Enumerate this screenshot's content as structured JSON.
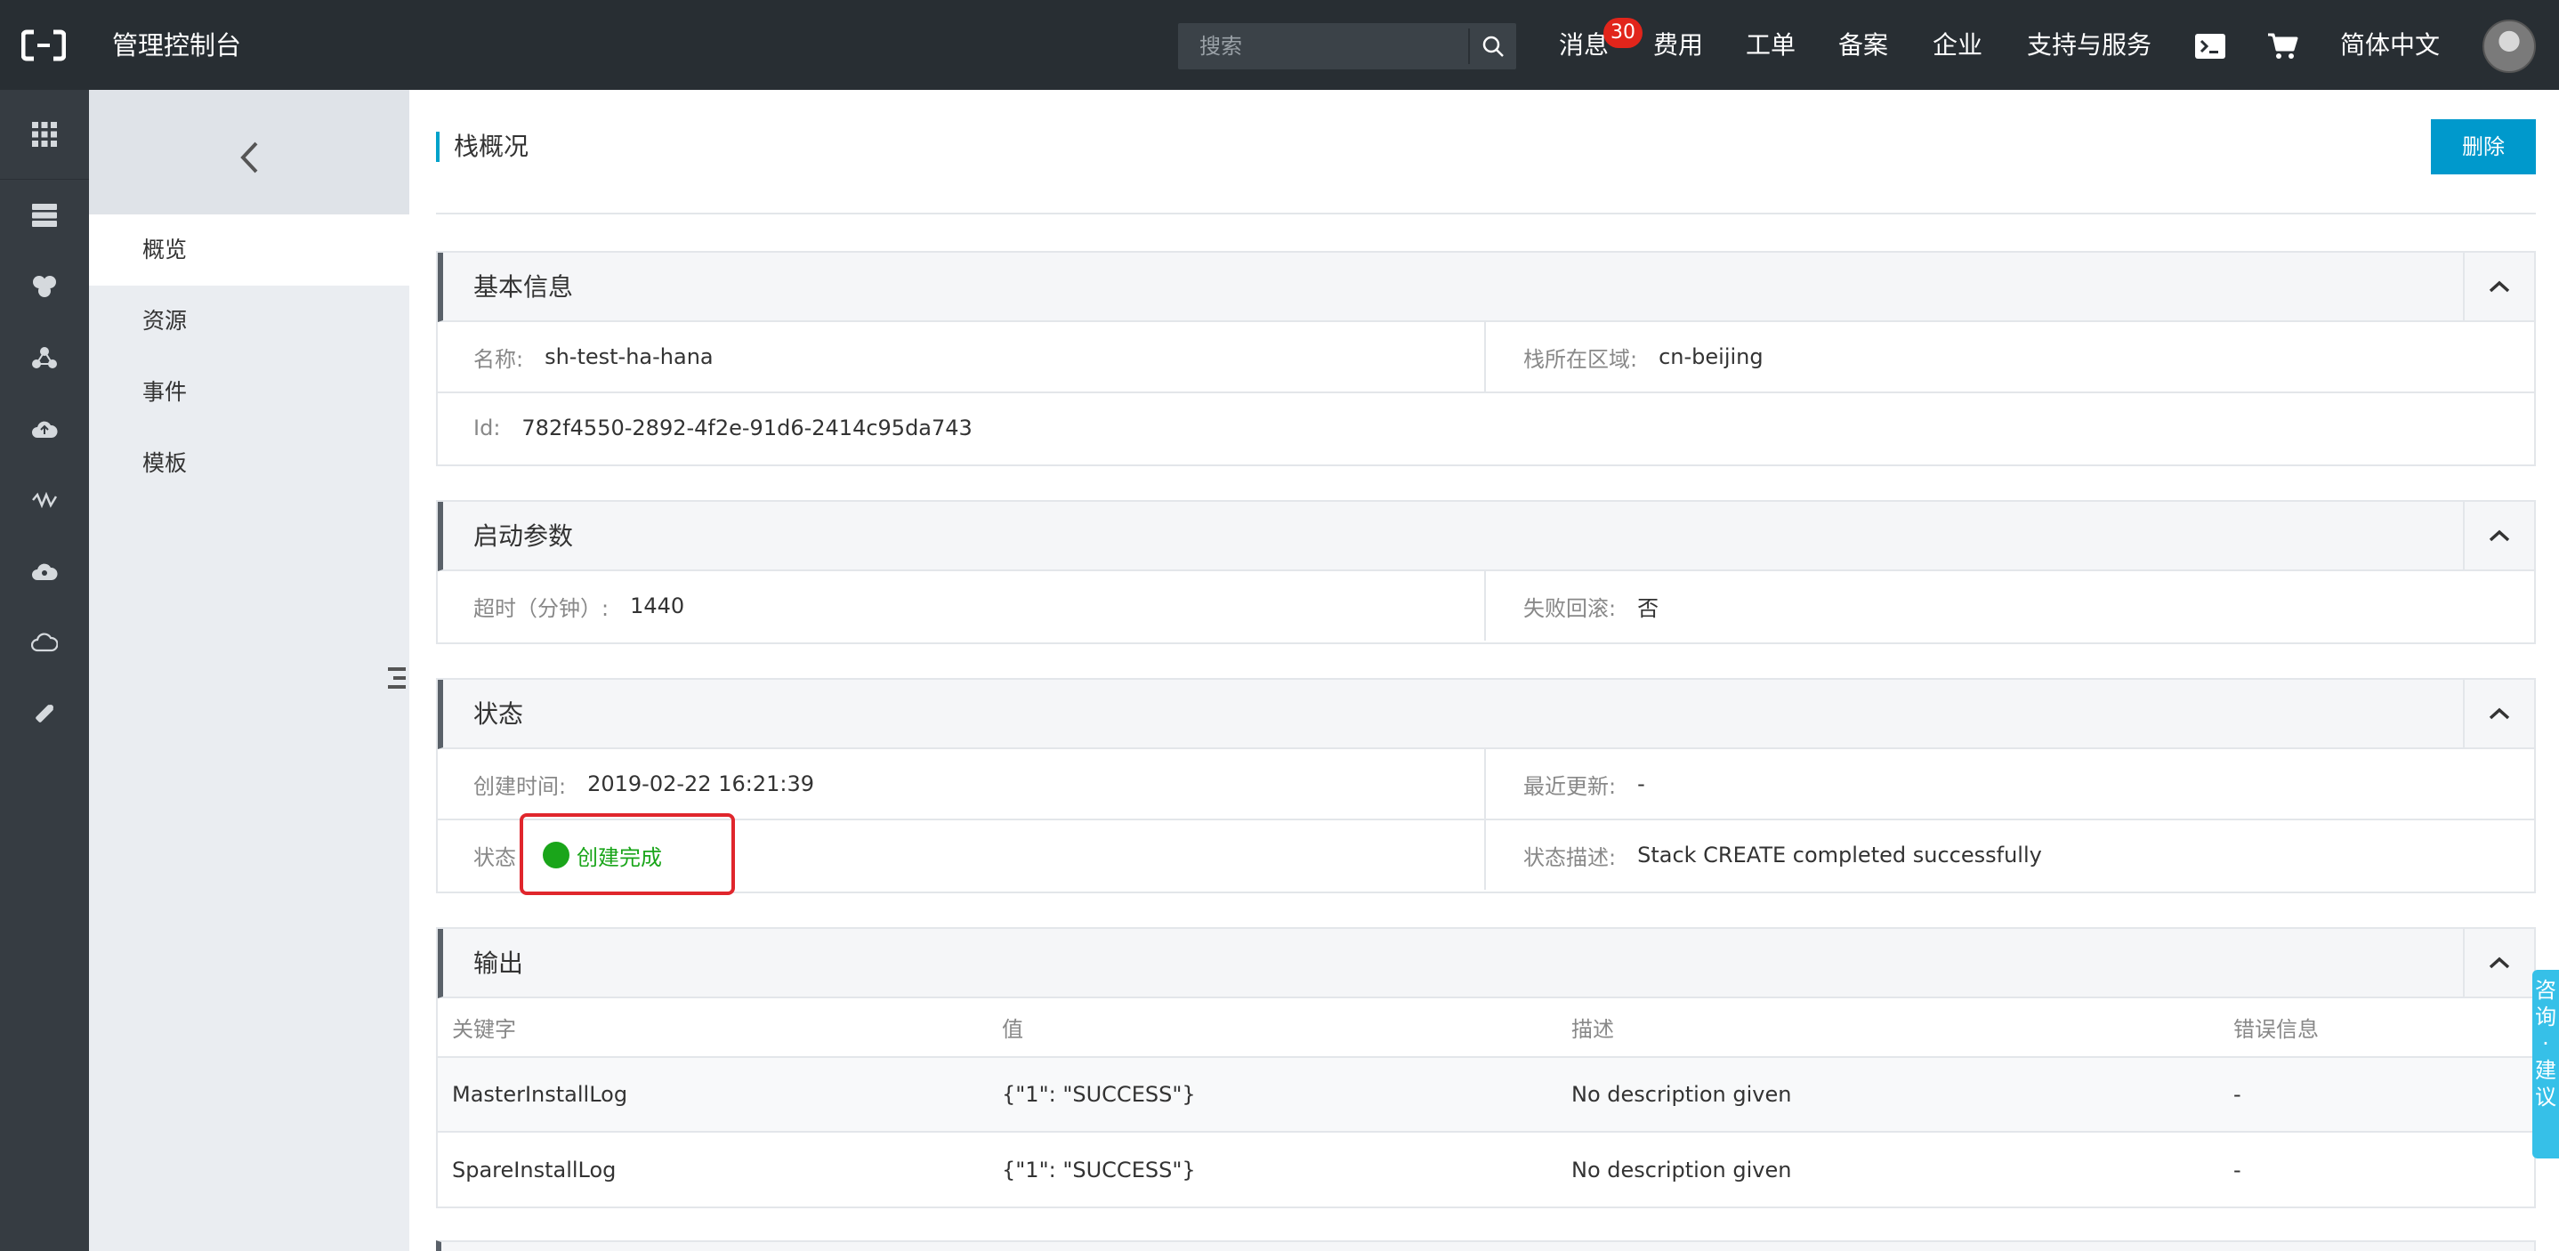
{
  "topbar": {
    "app_title": "管理控制台",
    "search": {
      "placeholder": "搜索"
    },
    "nav": {
      "messages": "消息",
      "messages_badge": "30",
      "billing": "费用",
      "tickets": "工单",
      "icp": "备案",
      "enterprise": "企业",
      "support": "支持与服务",
      "language": "简体中文"
    }
  },
  "subnav": {
    "items": [
      {
        "label": "概览",
        "active": true
      },
      {
        "label": "资源",
        "active": false
      },
      {
        "label": "事件",
        "active": false
      },
      {
        "label": "模板",
        "active": false
      }
    ]
  },
  "page": {
    "title": "栈概况",
    "delete_label": "删除"
  },
  "basic_info": {
    "title": "基本信息",
    "name_key": "名称:",
    "name_value": "sh-test-ha-hana",
    "region_key": "栈所在区域:",
    "region_value": "cn-beijing",
    "id_key": "Id:",
    "id_value": "782f4550-2892-4f2e-91d6-2414c95da743"
  },
  "launch_params": {
    "title": "启动参数",
    "timeout_key": "超时（分钟）:",
    "timeout_value": "1440",
    "rollback_key": "失败回滚:",
    "rollback_value": "否"
  },
  "status": {
    "title": "状态",
    "created_key": "创建时间:",
    "created_value": "2019-02-22 16:21:39",
    "updated_key": "最近更新:",
    "updated_value": "-",
    "status_key": "状态",
    "status_value": "创建完成",
    "status_color": "#1aa51a",
    "desc_key": "状态描述:",
    "desc_value": "Stack CREATE completed successfully"
  },
  "output": {
    "title": "输出",
    "columns": [
      "关键字",
      "值",
      "描述",
      "错误信息"
    ],
    "rows": [
      [
        "MasterInstallLog",
        "{\"1\": \"SUCCESS\"}",
        "No description given",
        "-"
      ],
      [
        "SpareInstallLog",
        "{\"1\": \"SUCCESS\"}",
        "No description given",
        "-"
      ]
    ]
  },
  "feedback": {
    "label": "咨询·建议"
  },
  "colors": {
    "topbar_bg": "#282e33",
    "accent": "#0099cc",
    "badge": "#e1251b",
    "highlight": "#e0262c"
  }
}
